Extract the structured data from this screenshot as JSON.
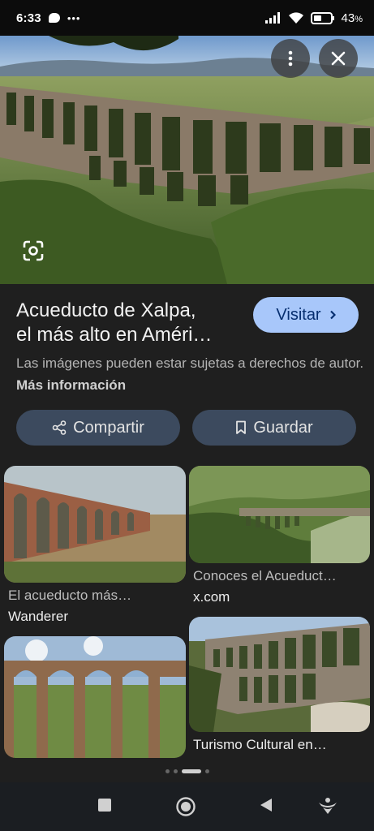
{
  "status_bar": {
    "time": "6:33",
    "battery": "43",
    "battery_unit": "%"
  },
  "result": {
    "title_line1": "Acueducto de Xalpa,",
    "title_line2": "el más alto en Améri…",
    "visit_label": "Visitar",
    "rights_text": "Las imágenes pueden estar sujetas a derechos de autor.",
    "rights_link": "Más información",
    "share_label": "Compartir",
    "save_label": "Guardar"
  },
  "related": [
    {
      "caption": "El acueducto más…",
      "source": "Wanderer"
    },
    {
      "caption": "Conoces el Acueduct…",
      "source": "x.com"
    },
    {
      "caption": "",
      "source": ""
    },
    {
      "caption": "Turismo Cultural en…",
      "source": ""
    }
  ],
  "icons": {
    "menu": "more-vert-icon",
    "close": "close-icon",
    "lens": "lens-icon",
    "share": "share-icon",
    "save": "bookmark-icon",
    "nav": [
      "square-icon",
      "circle-icon",
      "triangle-back-icon",
      "accessibility-icon"
    ]
  },
  "colors": {
    "background": "#1f1f1f",
    "visit_button": "#a8c7fa",
    "action_button": "#3c4a5e"
  }
}
